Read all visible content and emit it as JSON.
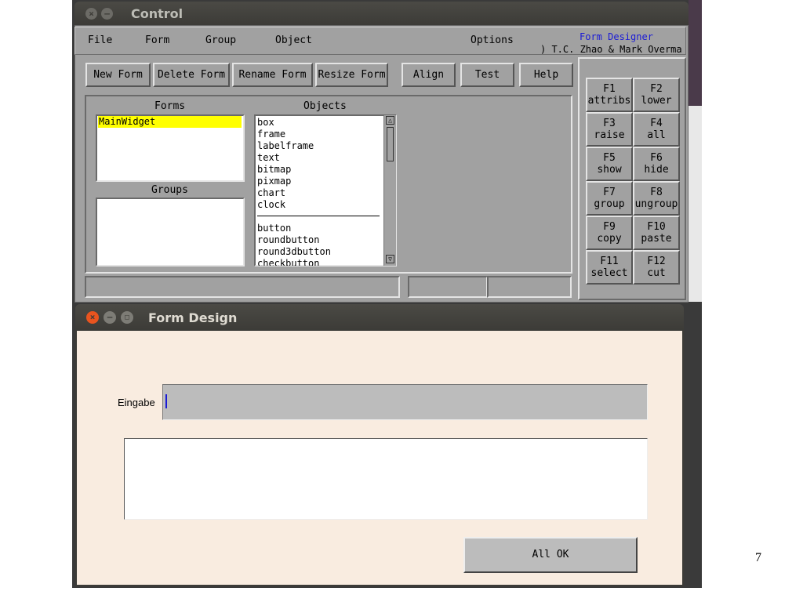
{
  "control_window": {
    "title": "Control",
    "menu": [
      "File",
      "Form",
      "Group",
      "Object",
      "Options"
    ],
    "form_designer": "Form Designer",
    "authors": ") T.C. Zhao & Mark Overma",
    "toolbar": [
      "New Form",
      "Delete Form",
      "Rename Form",
      "Resize Form",
      "Align",
      "Test",
      "Help"
    ],
    "forms_label": "Forms",
    "groups_label": "Groups",
    "objects_label": "Objects",
    "forms": [
      "MainWidget"
    ],
    "objects_group1": [
      "box",
      "frame",
      "labelframe",
      "text",
      "bitmap",
      "pixmap",
      "chart",
      "clock"
    ],
    "objects_group2": [
      "button",
      "roundbutton",
      "round3dbutton",
      "checkbutton"
    ],
    "function_keys": [
      {
        "key": "F1",
        "action": "attribs"
      },
      {
        "key": "F2",
        "action": "lower"
      },
      {
        "key": "F3",
        "action": "raise"
      },
      {
        "key": "F4",
        "action": "all"
      },
      {
        "key": "F5",
        "action": "show"
      },
      {
        "key": "F6",
        "action": "hide"
      },
      {
        "key": "F7",
        "action": "group"
      },
      {
        "key": "F8",
        "action": "ungroup"
      },
      {
        "key": "F9",
        "action": "copy"
      },
      {
        "key": "F10",
        "action": "paste"
      },
      {
        "key": "F11",
        "action": "select"
      },
      {
        "key": "F12",
        "action": "cut"
      }
    ]
  },
  "form_design_window": {
    "title": "Form Design",
    "input_label": "Eingabe",
    "input_value": "",
    "ok_button": "All OK"
  },
  "page_number": "7",
  "colors": {
    "selection": "#ffff00",
    "accent_text": "#1a1ad6",
    "form_bg": "#f9ece0",
    "panel_bg": "#a1a1a1"
  }
}
